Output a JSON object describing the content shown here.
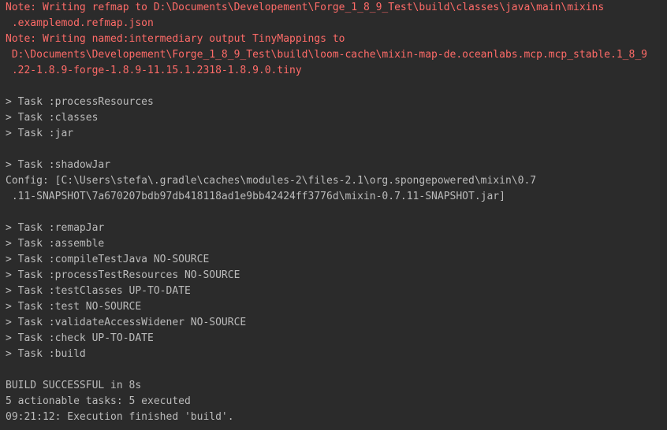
{
  "colors": {
    "background": "#2b2b2b",
    "text": "#bbbbbb",
    "error_text": "#ff6b68"
  },
  "console": {
    "lines": [
      {
        "text": "Note: Writing refmap to D:\\Documents\\Developement\\Forge_1_8_9_Test\\build\\classes\\java\\main\\mixins",
        "kind": "err"
      },
      {
        "text": " .examplemod.refmap.json",
        "kind": "err"
      },
      {
        "text": "Note: Writing named:intermediary output TinyMappings to",
        "kind": "err"
      },
      {
        "text": " D:\\Documents\\Developement\\Forge_1_8_9_Test\\build\\loom-cache\\mixin-map-de.oceanlabs.mcp.mcp_stable.1_8_9",
        "kind": "err"
      },
      {
        "text": " .22-1.8.9-forge-1.8.9-11.15.1.2318-1.8.9.0.tiny",
        "kind": "err"
      },
      {
        "text": "",
        "kind": "blank"
      },
      {
        "text": "> Task :processResources",
        "kind": "out"
      },
      {
        "text": "> Task :classes",
        "kind": "out"
      },
      {
        "text": "> Task :jar",
        "kind": "out"
      },
      {
        "text": "",
        "kind": "blank"
      },
      {
        "text": "> Task :shadowJar",
        "kind": "out"
      },
      {
        "text": "Config: [C:\\Users\\stefa\\.gradle\\caches\\modules-2\\files-2.1\\org.spongepowered\\mixin\\0.7",
        "kind": "out"
      },
      {
        "text": " .11-SNAPSHOT\\7a670207bdb97db418118ad1e9bb42424ff3776d\\mixin-0.7.11-SNAPSHOT.jar]",
        "kind": "out"
      },
      {
        "text": "",
        "kind": "blank"
      },
      {
        "text": "> Task :remapJar",
        "kind": "out"
      },
      {
        "text": "> Task :assemble",
        "kind": "out"
      },
      {
        "text": "> Task :compileTestJava NO-SOURCE",
        "kind": "out"
      },
      {
        "text": "> Task :processTestResources NO-SOURCE",
        "kind": "out"
      },
      {
        "text": "> Task :testClasses UP-TO-DATE",
        "kind": "out"
      },
      {
        "text": "> Task :test NO-SOURCE",
        "kind": "out"
      },
      {
        "text": "> Task :validateAccessWidener NO-SOURCE",
        "kind": "out"
      },
      {
        "text": "> Task :check UP-TO-DATE",
        "kind": "out"
      },
      {
        "text": "> Task :build",
        "kind": "out"
      },
      {
        "text": "",
        "kind": "blank"
      },
      {
        "text": "BUILD SUCCESSFUL in 8s",
        "kind": "out"
      },
      {
        "text": "5 actionable tasks: 5 executed",
        "kind": "out"
      },
      {
        "text": "09:21:12: Execution finished 'build'.",
        "kind": "out"
      }
    ]
  }
}
